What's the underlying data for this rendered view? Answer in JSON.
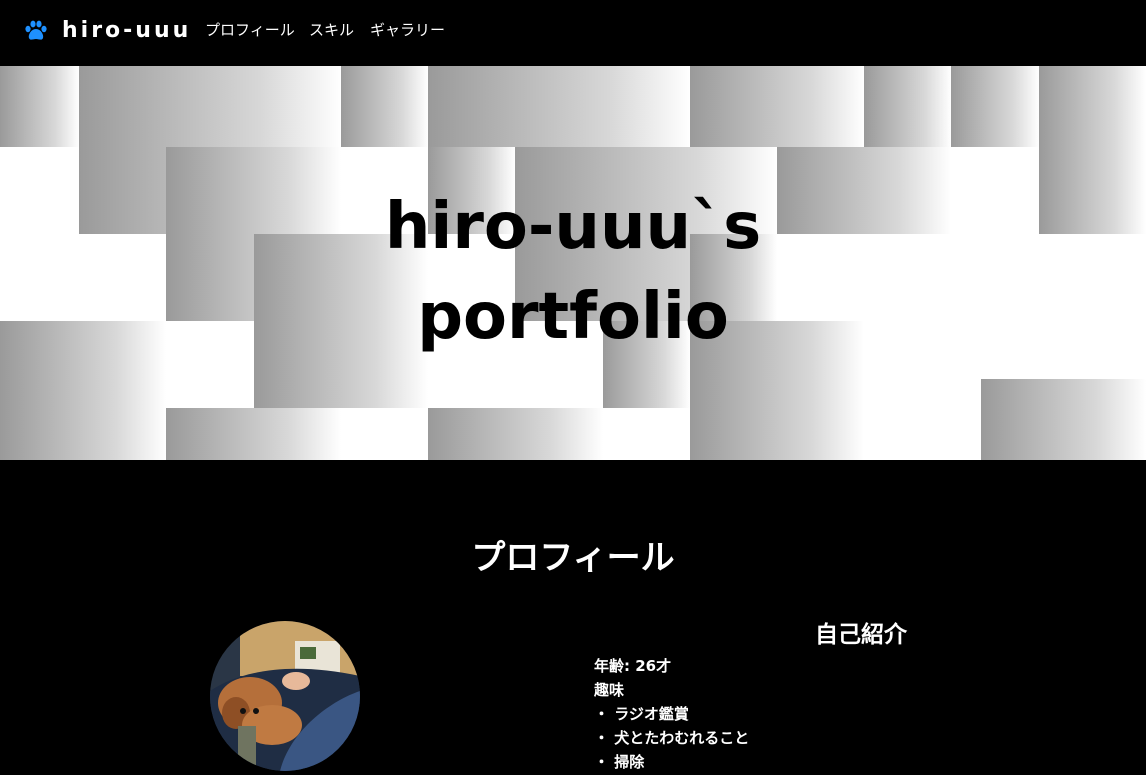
{
  "header": {
    "brand": "hiro-uuu",
    "brand_icon": "paw-icon",
    "brand_icon_color": "#1e90ff",
    "nav": [
      "プロフィール",
      "スキル",
      "ギャラリー"
    ]
  },
  "hero": {
    "title_line1": "hiro-uuu`s",
    "title_line2": "portfolio"
  },
  "profile": {
    "title": "プロフィール",
    "avatar": "dog-photo",
    "intro_heading": "自己紹介",
    "age": "年齢: 26才",
    "hobby_label": "趣味",
    "hobbies": [
      "・ ラジオ鑑賞",
      "・ 犬とたわむれること",
      "・ 掃除"
    ]
  }
}
